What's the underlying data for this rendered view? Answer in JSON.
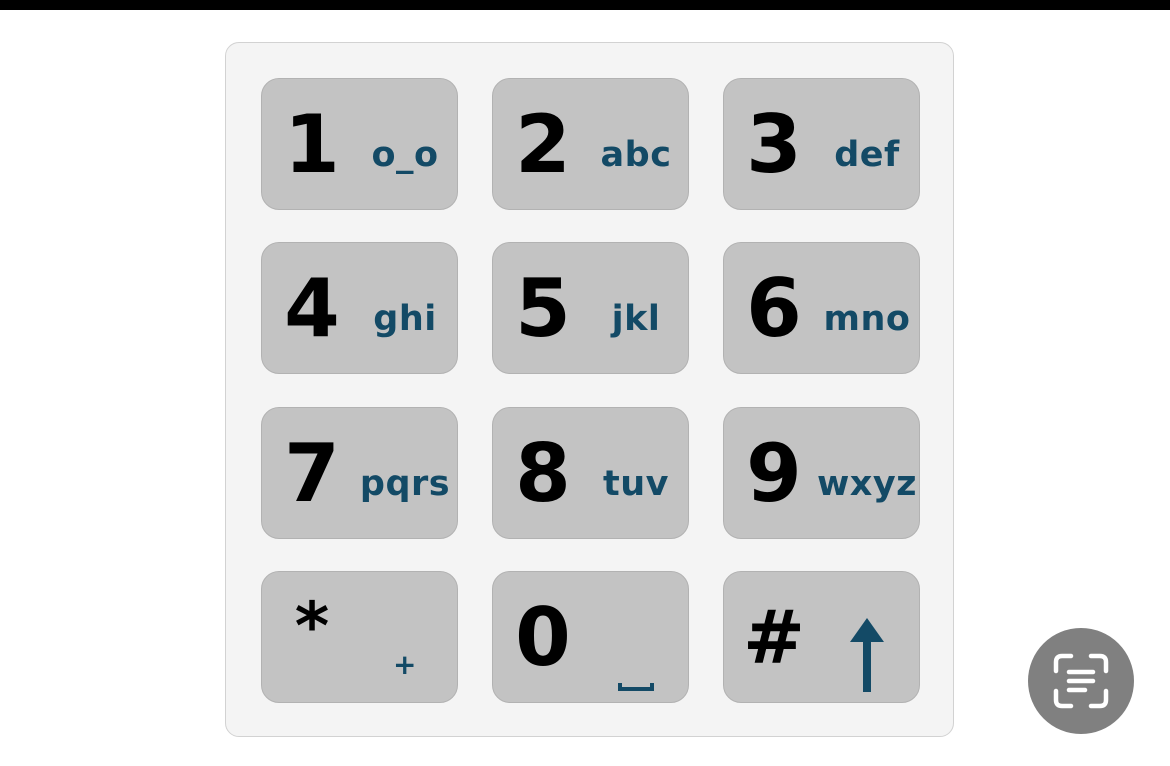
{
  "keypad": {
    "keys": [
      {
        "digit": "1",
        "letters": "o_o"
      },
      {
        "digit": "2",
        "letters": "abc"
      },
      {
        "digit": "3",
        "letters": "def"
      },
      {
        "digit": "4",
        "letters": "ghi"
      },
      {
        "digit": "5",
        "letters": "jkl"
      },
      {
        "digit": "6",
        "letters": "mno"
      },
      {
        "digit": "7",
        "letters": "pqrs"
      },
      {
        "digit": "8",
        "letters": "tuv"
      },
      {
        "digit": "9",
        "letters": "wxyz"
      },
      {
        "digit": "*",
        "letters": "+"
      },
      {
        "digit": "0",
        "letters": "space-icon"
      },
      {
        "digit": "#",
        "letters": "shift-arrow-icon"
      }
    ]
  },
  "ocr_button": {
    "icon": "scan-text-icon"
  },
  "colors": {
    "key_background": "#c3c3c3",
    "panel_background": "#f4f4f4",
    "digit": "#000000",
    "letters": "#134a66",
    "ocr_button": "#808080"
  }
}
